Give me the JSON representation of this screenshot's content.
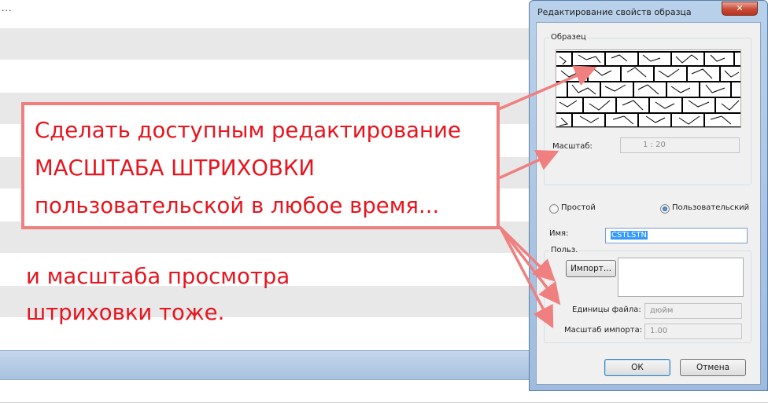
{
  "background": {
    "ellipsis": "..."
  },
  "callout": {
    "lines": [
      "Сделать доступным редактирование",
      "МАСШТАБА ШТРИХОВКИ",
      "пользовательской в любое время..."
    ],
    "sub_lines": [
      "и масштаба просмотра",
      "штриховки тоже."
    ],
    "color": "#e8141e",
    "border_color": "#f08080"
  },
  "dialog": {
    "title": "Редактирование свойств образца",
    "close_label": "✕",
    "sample_group": {
      "label": "Образец",
      "pattern_icon": "crosshatch-stone-pattern"
    },
    "scale": {
      "label": "Масштаб:",
      "value": "1 : 20"
    },
    "type_options": {
      "simple_label": "Простой",
      "custom_label": "Пользовательский",
      "selected": "custom"
    },
    "name": {
      "label": "Имя:",
      "value": "CSTLSTN"
    },
    "custom_group": {
      "label": "Польз.",
      "import_button": "Импорт...",
      "file_units_label": "Единицы файла:",
      "file_units_value": "дюйм",
      "import_scale_label": "Масштаб импорта:",
      "import_scale_value": "1.00"
    },
    "ok_label": "ОК",
    "cancel_label": "Отмена"
  }
}
